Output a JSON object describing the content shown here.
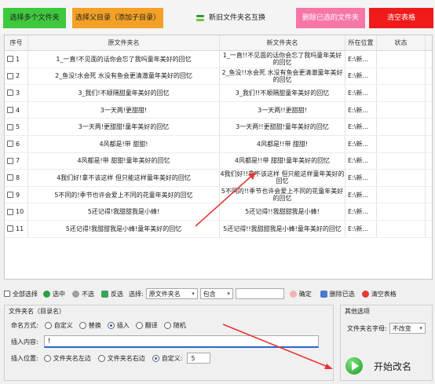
{
  "toolbar": {
    "select_folders": "选择多个文件夹",
    "select_parent": "选择父目录（添加子目录）",
    "swap_names": "新旧文件夹名互换",
    "delete_selected": "删除已选的文件夹",
    "clear_table": "清空表格"
  },
  "grid": {
    "columns": {
      "no": "序号",
      "orig": "原文件夹名",
      "new": "新文件夹名",
      "loc": "所在位置",
      "status": "状态"
    },
    "rows": [
      {
        "no": "1",
        "orig": "1_一直!不见面的话你会忘了我吗童年美好的回忆",
        "new": "1_一直!!不见面的话你会忘了我吗童年美好的回忆",
        "loc": "E:\\新..."
      },
      {
        "no": "2",
        "orig": "2_鱼没!水会死 水没有鱼会更清澈童年美好的回忆",
        "new": "2_鱼没!!水会死 水没有鱼会更清澈童年美好的回忆",
        "loc": "E:\\新..."
      },
      {
        "no": "3",
        "orig": "3_我们!不顺隔甜童年美好的回忆",
        "new": "3_我们!!不顺隔甜童年美好的回忆",
        "loc": "E:\\新..."
      },
      {
        "no": "4",
        "orig": "3一天两!更甜甜!",
        "new": "3一天两!!更甜甜!",
        "loc": "E:\\新..."
      },
      {
        "no": "5",
        "orig": "3一天两!更甜甜!童年美好的回忆",
        "new": "3一天两!!更甜甜!童年美好的回忆",
        "loc": "E:\\新..."
      },
      {
        "no": "6",
        "orig": "4风都是!带  甜甜!",
        "new": "4风都是!!带  甜甜!",
        "loc": "E:\\新..."
      },
      {
        "no": "7",
        "orig": "4风都是!带  甜甜!童年美好的回忆",
        "new": "4风都是!!带  甜甜!童年美好的回忆",
        "loc": "E:\\新..."
      },
      {
        "no": "8",
        "orig": "4我们好!拿不该这样 但只能这样童年美好的回忆",
        "new": "4我们好!!拿不该这样 但只能这样童年美好的回忆",
        "loc": "E:\\新..."
      },
      {
        "no": "9",
        "orig": "5不同的!季节也许会爱上不同的花童年美好的回忆",
        "new": "5不同的!!季节也许会爱上不同的花童年美好的回忆",
        "loc": "E:\\新..."
      },
      {
        "no": "10",
        "orig": "5还记得!我甜甜我是小蜂!",
        "new": "5还记得!!我甜甜我是小蜂!",
        "loc": "E:\\新..."
      },
      {
        "no": "11",
        "orig": "5还记得!我甜甜我是小蜂!童年美好的回忆",
        "new": "5还记得!!我甜甜我是小蜂!童年美好的回忆",
        "loc": "E:\\新..."
      }
    ]
  },
  "filter_bar": {
    "select_all": "全部选择",
    "select_mid": "选中",
    "deselect": "不选",
    "invert": "反选",
    "choose_label": "选择:",
    "field_value": "原文件夹名",
    "match_value": "包含",
    "confirm": "确定",
    "delete_selected": "删除已选",
    "clear_table": "清空表格"
  },
  "rename_panel": {
    "title": "文件夹名（目录名）",
    "mode_label": "命名方式:",
    "modes": [
      "自定义",
      "替换",
      "插入",
      "翻译",
      "随机"
    ],
    "insert_label": "插入内容:",
    "insert_value": "!",
    "position_label": "插入位置:",
    "positions": [
      "文件夹名左边",
      "文件夹名右边",
      "自定义:"
    ],
    "custom_pos": "5"
  },
  "other_panel": {
    "title": "其他选项",
    "case_label": "文件夹名字母:",
    "case_value": "不改变"
  },
  "start_button": "开始改名"
}
